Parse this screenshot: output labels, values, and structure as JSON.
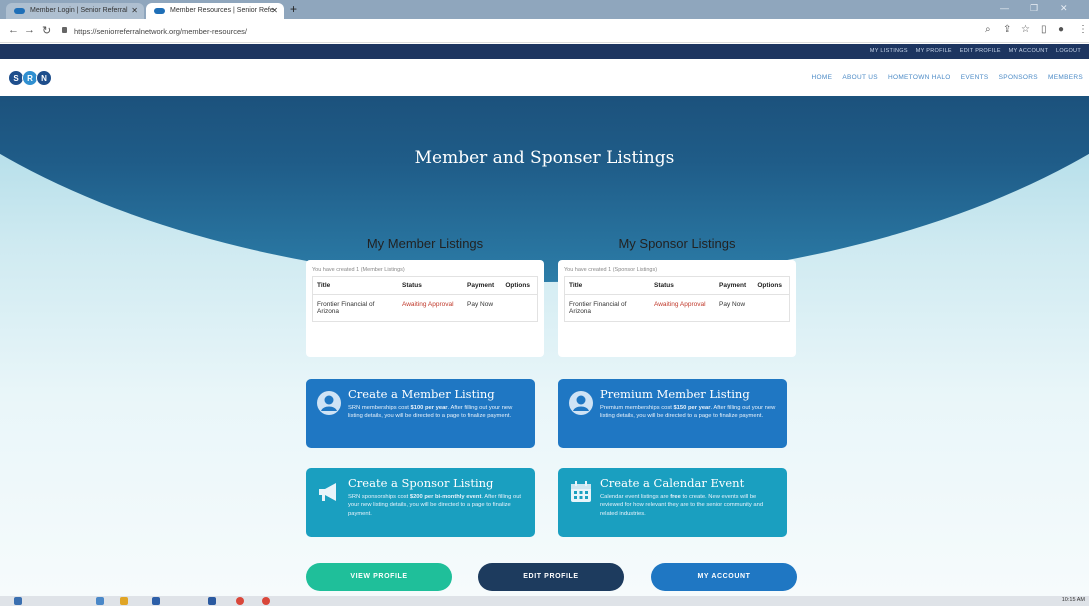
{
  "browser": {
    "tabs": [
      {
        "title": "Member Login | Senior Referral"
      },
      {
        "title": "Member Resources | Senior Refe"
      }
    ],
    "new_tab": "+",
    "url": "https://seniorreferralnetwork.org/member-resources/",
    "window_controls": {
      "min": "—",
      "max": "❐",
      "close": "✕"
    }
  },
  "topbar": {
    "links": [
      "MY LISTINGS",
      "MY PROFILE",
      "EDIT PROFILE",
      "MY ACCOUNT",
      "LOGOUT"
    ]
  },
  "site": {
    "logo_letters": [
      "S",
      "R",
      "N"
    ],
    "logo_colors": [
      "#1e4e8c",
      "#2f8fd0",
      "#1e4e8c"
    ],
    "nav": [
      "HOME",
      "ABOUT US",
      "HOMETOWN HALO",
      "EVENTS",
      "SPONSORS",
      "MEMBERS"
    ]
  },
  "hero": {
    "title": "Member and Sponser Listings"
  },
  "member_listings": {
    "heading": "My Member Listings",
    "created_text": "You have created 1 (Member Listings)",
    "columns": [
      "Title",
      "Status",
      "Payment",
      "Options"
    ],
    "rows": [
      {
        "title": "Frontier Financial of Arizona",
        "status": "Awaiting Approval",
        "payment": "Pay Now",
        "options": ""
      }
    ]
  },
  "sponsor_listings": {
    "heading": "My Sponsor Listings",
    "created_text": "You have created 1 (Sponsor Listings)",
    "columns": [
      "Title",
      "Status",
      "Payment",
      "Options"
    ],
    "rows": [
      {
        "title": "Frontier Financial of Arizona",
        "status": "Awaiting Approval",
        "payment": "Pay Now",
        "options": ""
      }
    ]
  },
  "actions": {
    "member": {
      "title": "Create a Member Listing",
      "desc_pre": "SRN memberships cost ",
      "desc_bold": "$100 per year",
      "desc_post": ". After filling out your new listing details, you will be directed to a page to finalize payment."
    },
    "premium": {
      "title": "Premium Member Listing",
      "desc_pre": "Premium memberships cost ",
      "desc_bold": "$150 per year",
      "desc_post": ". After filling out your new listing details, you will be directed to a page to finalize payment."
    },
    "sponsor": {
      "title": "Create a Sponsor Listing",
      "desc_pre": "SRN sponsorships cost ",
      "desc_bold": "$200 per bi-monthly event",
      "desc_post": ". After filling out your new listing details, you will be directed to a page to finalize payment."
    },
    "calendar": {
      "title": "Create a Calendar Event",
      "desc_pre": "Calendar event listings are ",
      "desc_bold": "free",
      "desc_post": " to create. New events will be reviewed for how relevant they are to the senior community and related industries."
    }
  },
  "buttons": {
    "view_profile": "VIEW PROFILE",
    "edit_profile": "EDIT PROFILE",
    "my_account": "MY ACCOUNT"
  },
  "colors": {
    "view_profile": "#1fbf9a",
    "edit_profile": "#1d3b5e",
    "my_account": "#1f77c3"
  },
  "taskbar": {
    "clock": "10:15 AM"
  }
}
